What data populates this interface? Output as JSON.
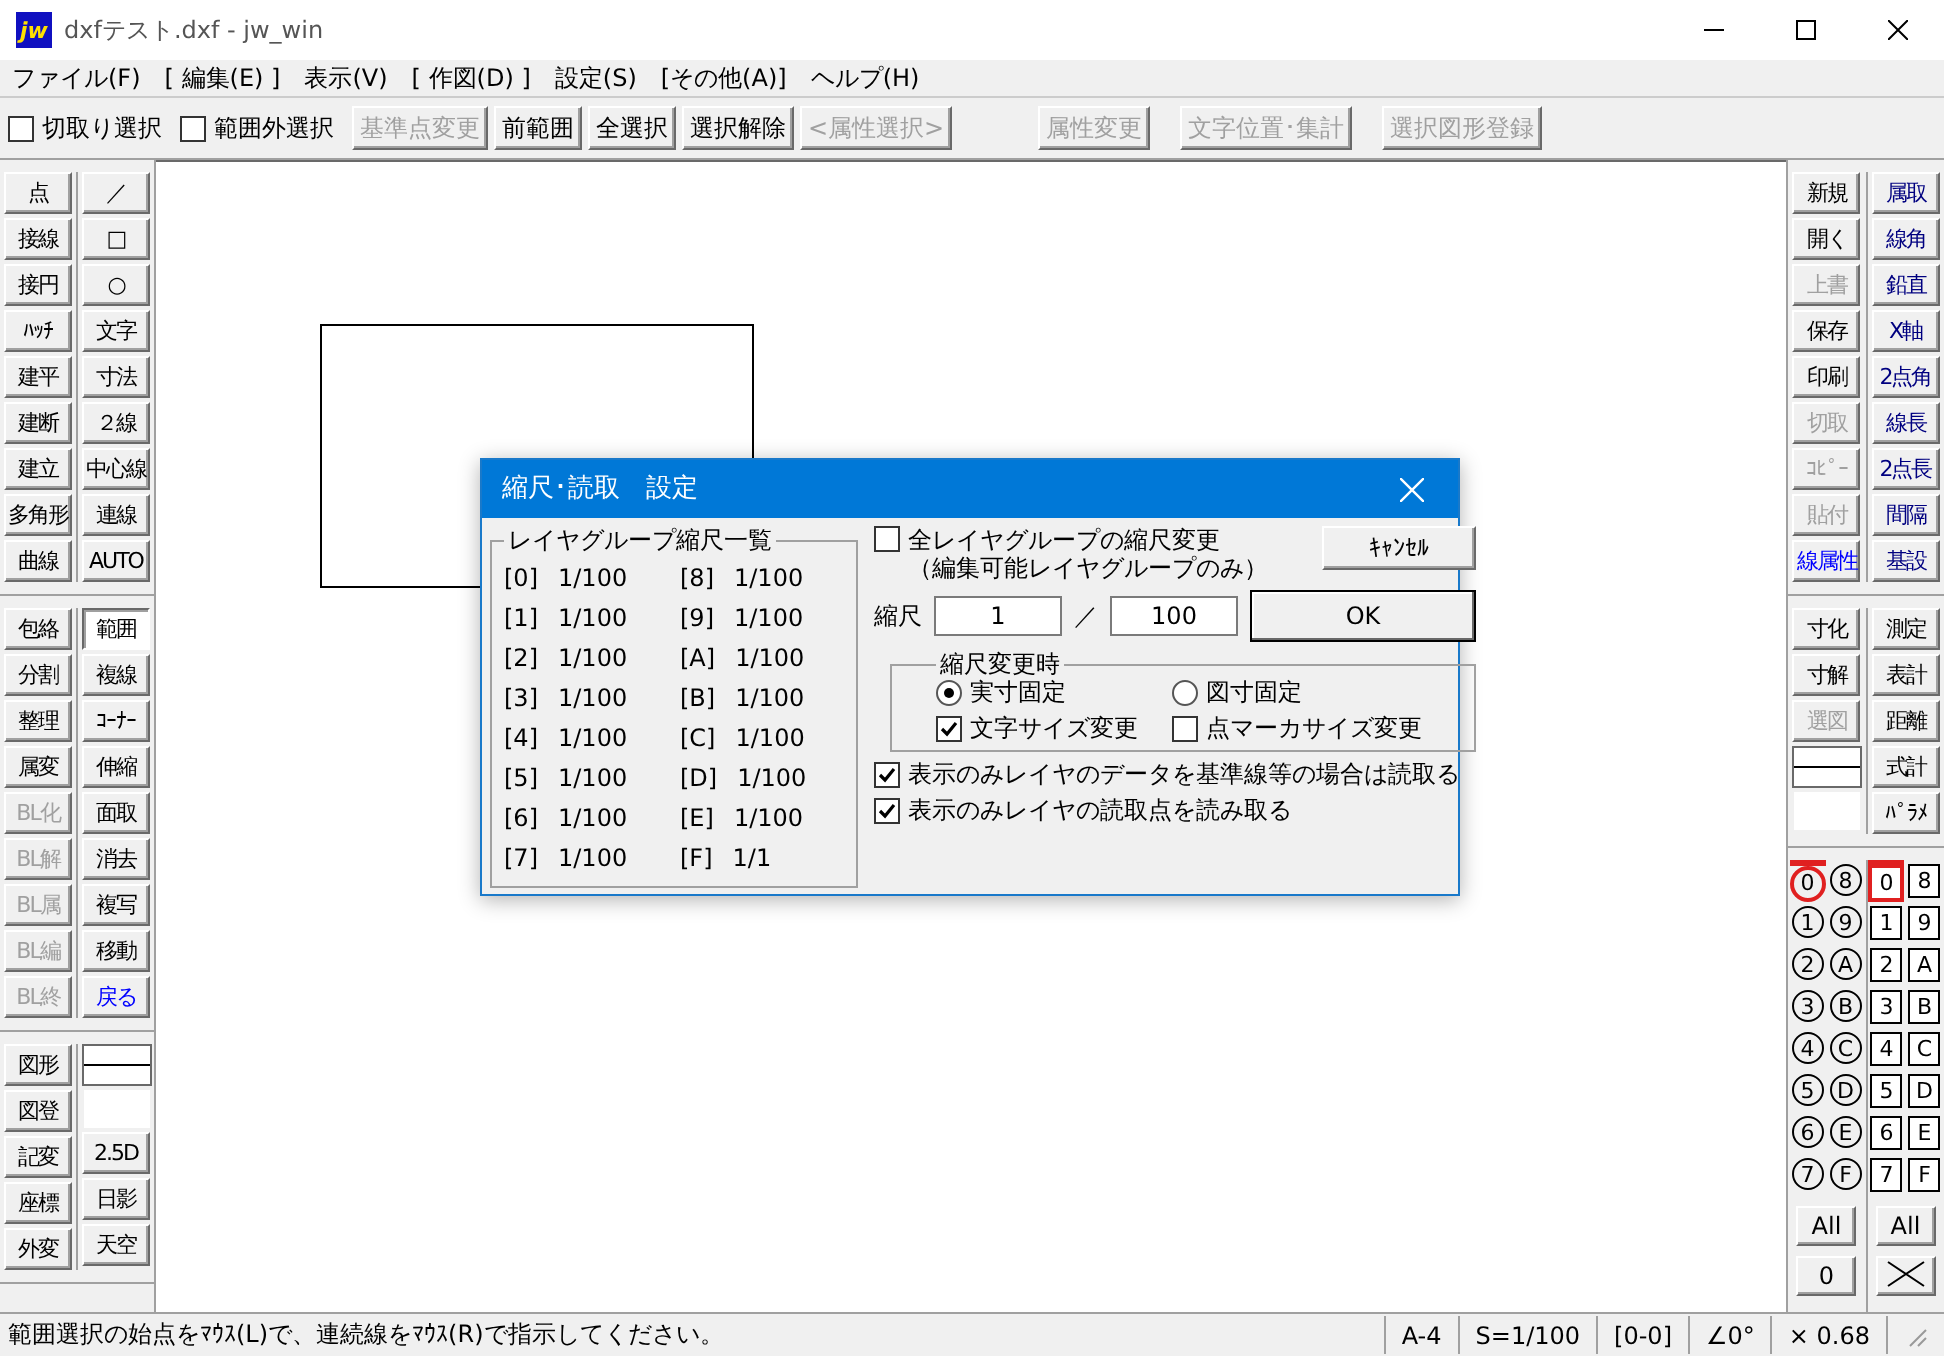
{
  "window": {
    "logo": "jw",
    "title": "dxfテスト.dxf - jw_win"
  },
  "menu": [
    "ファイル(F)",
    "[ 編集(E) ]",
    "表示(V)",
    "[ 作図(D) ]",
    "設定(S)",
    "[その他(A)]",
    "ヘルプ(H)"
  ],
  "toolbar": {
    "checkboxes": [
      {
        "label": "切取り選択",
        "checked": false
      },
      {
        "label": "範囲外選択",
        "checked": false
      }
    ],
    "buttons": [
      {
        "label": "基準点変更",
        "disabled": true
      },
      {
        "label": "前範囲",
        "disabled": false
      },
      {
        "label": "全選択",
        "disabled": false
      },
      {
        "label": "選択解除",
        "disabled": false
      },
      {
        "label": "<属性選択>",
        "disabled": true
      },
      {
        "label": "属性変更",
        "disabled": true
      },
      {
        "label": "文字位置･集計",
        "disabled": true
      },
      {
        "label": "選択図形登録",
        "disabled": true
      }
    ]
  },
  "left_toolbar": {
    "sections": [
      {
        "columns": [
          [
            {
              "label": "点",
              "disabled": false
            },
            {
              "label": "接線",
              "disabled": false
            },
            {
              "label": "接円",
              "disabled": false
            },
            {
              "label": "ﾊｯﾁ",
              "disabled": false
            },
            {
              "label": "建平",
              "disabled": false
            },
            {
              "label": "建断",
              "disabled": false
            },
            {
              "label": "建立",
              "disabled": false
            },
            {
              "label": "多角形",
              "disabled": false
            },
            {
              "label": "曲線",
              "disabled": false
            }
          ],
          [
            {
              "label": "／",
              "disabled": false
            },
            {
              "label": "□",
              "disabled": false
            },
            {
              "label": "○",
              "disabled": false
            },
            {
              "label": "文字",
              "disabled": false
            },
            {
              "label": "寸法",
              "disabled": false
            },
            {
              "label": "２線",
              "disabled": false
            },
            {
              "label": "中心線",
              "disabled": false
            },
            {
              "label": "連線",
              "disabled": false
            },
            {
              "label": "AUTO",
              "disabled": false
            }
          ]
        ]
      },
      {
        "columns": [
          [
            {
              "label": "包絡",
              "disabled": false
            },
            {
              "label": "分割",
              "disabled": false
            },
            {
              "label": "整理",
              "disabled": false
            },
            {
              "label": "属変",
              "disabled": false
            },
            {
              "label": "BL化",
              "disabled": true
            },
            {
              "label": "BL解",
              "disabled": true
            },
            {
              "label": "BL属",
              "disabled": true
            },
            {
              "label": "BL編",
              "disabled": true
            },
            {
              "label": "BL終",
              "disabled": true
            }
          ],
          [
            {
              "label": "範囲",
              "disabled": false,
              "pressed": true
            },
            {
              "label": "複線",
              "disabled": false,
              "pressed": false
            },
            {
              "label": "ｺｰﾅｰ",
              "disabled": false,
              "pressed": false
            },
            {
              "label": "伸縮",
              "disabled": false,
              "pressed": false
            },
            {
              "label": "面取",
              "disabled": false,
              "pressed": false
            },
            {
              "label": "消去",
              "disabled": false,
              "pressed": false
            },
            {
              "label": "複写",
              "disabled": false,
              "pressed": false
            },
            {
              "label": "移動",
              "disabled": false,
              "pressed": false
            },
            {
              "label": "戻る",
              "disabled": false,
              "pressed": false,
              "color": "#0000ff"
            }
          ]
        ]
      },
      {
        "columns": [
          [
            {
              "label": "図形",
              "disabled": false
            },
            {
              "label": "図登",
              "disabled": false
            },
            {
              "label": "記変",
              "disabled": false
            },
            {
              "label": "座標",
              "disabled": false
            },
            {
              "label": "外変",
              "disabled": false
            }
          ],
          [
            {
              "kind": "line_style"
            },
            {
              "kind": "blank"
            },
            {
              "kind": "button",
              "label": "2.5D",
              "disabled": false
            },
            {
              "kind": "button",
              "label": "日影",
              "disabled": false
            },
            {
              "kind": "button",
              "label": "天空",
              "disabled": false
            }
          ]
        ]
      }
    ]
  },
  "right_toolbar": {
    "sections": [
      {
        "columns": [
          [
            {
              "label": "新規",
              "disabled": false
            },
            {
              "label": "開く",
              "disabled": false
            },
            {
              "label": "上書",
              "disabled": true
            },
            {
              "label": "保存",
              "disabled": false
            },
            {
              "label": "印刷",
              "disabled": false
            },
            {
              "label": "切取",
              "disabled": true
            },
            {
              "label": "ｺﾋﾟｰ",
              "disabled": true
            },
            {
              "label": "貼付",
              "disabled": true
            },
            {
              "label": "線属性",
              "disabled": false,
              "color": "#0000ff"
            }
          ],
          [
            {
              "label": "属取",
              "disabled": false,
              "color": "#000080"
            },
            {
              "label": "線角",
              "disabled": false,
              "color": "#000080"
            },
            {
              "label": "鉛直",
              "disabled": false,
              "color": "#000080"
            },
            {
              "label": "X軸",
              "disabled": false,
              "color": "#000080"
            },
            {
              "label": "2点角",
              "disabled": false,
              "color": "#000080"
            },
            {
              "label": "線長",
              "disabled": false,
              "color": "#000080"
            },
            {
              "label": "2点長",
              "disabled": false,
              "color": "#000080"
            },
            {
              "label": "間隔",
              "disabled": false,
              "color": "#000080"
            },
            {
              "label": "基設",
              "disabled": false,
              "color": "#000080"
            }
          ]
        ]
      },
      {
        "columns": [
          [
            {
              "kind": "button",
              "label": "寸化",
              "disabled": false
            },
            {
              "kind": "button",
              "label": "寸解",
              "disabled": false
            },
            {
              "kind": "button",
              "label": "選図",
              "disabled": true
            },
            {
              "kind": "line_style"
            },
            {
              "kind": "blank"
            }
          ],
          [
            {
              "label": "測定",
              "disabled": false
            },
            {
              "label": "表計",
              "disabled": false
            },
            {
              "label": "距離",
              "disabled": false
            },
            {
              "label": "式計",
              "disabled": false
            },
            {
              "label": "ﾊﾟﾗﾒ",
              "disabled": false
            }
          ]
        ]
      }
    ],
    "layers": [
      {
        "label": "0",
        "selected": true
      },
      {
        "label": "1",
        "selected": false
      },
      {
        "label": "2",
        "selected": false
      },
      {
        "label": "3",
        "selected": false
      },
      {
        "label": "4",
        "selected": false
      },
      {
        "label": "5",
        "selected": false
      },
      {
        "label": "6",
        "selected": false
      },
      {
        "label": "7",
        "selected": false
      },
      {
        "label": "8",
        "selected": false
      },
      {
        "label": "9",
        "selected": false
      },
      {
        "label": "A",
        "selected": false
      },
      {
        "label": "B",
        "selected": false
      },
      {
        "label": "C",
        "selected": false
      },
      {
        "label": "D",
        "selected": false
      },
      {
        "label": "E",
        "selected": false
      },
      {
        "label": "F",
        "selected": false
      }
    ],
    "layer_groups": [
      {
        "label": "0",
        "selected": true
      },
      {
        "label": "1",
        "selected": false
      },
      {
        "label": "2",
        "selected": false
      },
      {
        "label": "3",
        "selected": false
      },
      {
        "label": "4",
        "selected": false
      },
      {
        "label": "5",
        "selected": false
      },
      {
        "label": "6",
        "selected": false
      },
      {
        "label": "7",
        "selected": false
      },
      {
        "label": "8",
        "selected": false
      },
      {
        "label": "9",
        "selected": false
      },
      {
        "label": "A",
        "selected": false
      },
      {
        "label": "B",
        "selected": false
      },
      {
        "label": "C",
        "selected": false
      },
      {
        "label": "D",
        "selected": false
      },
      {
        "label": "E",
        "selected": false
      },
      {
        "label": "F",
        "selected": false
      }
    ],
    "layer_buttons": [
      "All",
      "0"
    ],
    "group_buttons": [
      "All"
    ]
  },
  "dialog": {
    "title": "縮尺･読取　設定",
    "scale_list": {
      "title": "レイヤグループ縮尺一覧",
      "rows": [
        {
          "group": "[0]",
          "scale": "1/100"
        },
        {
          "group": "[1]",
          "scale": "1/100"
        },
        {
          "group": "[2]",
          "scale": "1/100"
        },
        {
          "group": "[3]",
          "scale": "1/100"
        },
        {
          "group": "[4]",
          "scale": "1/100"
        },
        {
          "group": "[5]",
          "scale": "1/100"
        },
        {
          "group": "[6]",
          "scale": "1/100"
        },
        {
          "group": "[7]",
          "scale": "1/100"
        },
        {
          "group": "[8]",
          "scale": "1/100"
        },
        {
          "group": "[9]",
          "scale": "1/100"
        },
        {
          "group": "[A]",
          "scale": "1/100"
        },
        {
          "group": "[B]",
          "scale": "1/100"
        },
        {
          "group": "[C]",
          "scale": "1/100"
        },
        {
          "group": "[D]",
          "scale": "1/100"
        },
        {
          "group": "[E]",
          "scale": "1/100"
        },
        {
          "group": "[F]",
          "scale": "1/1"
        }
      ]
    },
    "all_groups": {
      "label": "全レイヤグループの縮尺変更",
      "note": "（編集可能レイヤグループのみ）",
      "checked": false
    },
    "cancel": "ｷｬﾝｾﾙ",
    "scale": {
      "label": "縮尺",
      "numerator": "1",
      "separator": "／",
      "denominator": "100"
    },
    "ok": "OK",
    "on_change": {
      "title": "縮尺変更時",
      "radios": [
        {
          "label": "実寸固定",
          "selected": true
        },
        {
          "label": "図寸固定",
          "selected": false
        }
      ],
      "checkboxes": [
        {
          "label": "文字サイズ変更",
          "checked": true
        },
        {
          "label": "点マーカサイズ変更",
          "checked": false
        }
      ]
    },
    "options": [
      {
        "label": "表示のみレイヤのデータを基準線等の場合は読取る",
        "checked": true
      },
      {
        "label": "表示のみレイヤの読取点を読み取る",
        "checked": true
      }
    ]
  },
  "status_bar": {
    "message": "範囲選択の始点をﾏｳｽ(L)で、連続線をﾏｳｽ(R)で指示してください。",
    "cells": [
      "A-4",
      "S=1/100",
      "[0-0]",
      "∠0°",
      "× 0.68"
    ]
  }
}
